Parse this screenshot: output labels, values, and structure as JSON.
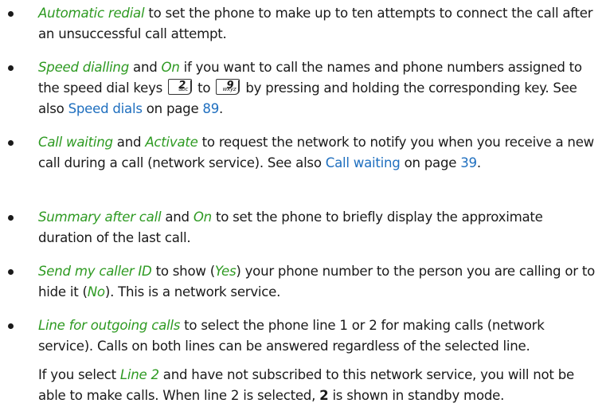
{
  "items": [
    {
      "term": "Automatic redial",
      "text": " to set the phone to make up to ten attempts to connect the call after an unsuccessful call attempt."
    },
    {
      "term": "Speed dialling",
      "and": " and ",
      "option": "On",
      "text1": " if you want to call the names and phone numbers assigned to the speed dial keys",
      "to": " to ",
      "text2": " by pressing and holding the corresponding key. See also ",
      "link": "Speed dials",
      "text3": " on page ",
      "page": "89",
      "end": ".",
      "key_from": {
        "digit": "2",
        "letters": "abc",
        "icon": "key-2-icon"
      },
      "key_to": {
        "digit": "9",
        "letters": "wxyz",
        "icon": "key-9-icon"
      }
    },
    {
      "term": "Call waiting",
      "and": " and ",
      "option": "Activate",
      "text1": " to request the network to notify you when you receive a new call during a call (network service). See also ",
      "link": "Call waiting",
      "text2": " on page ",
      "page": "39",
      "end": "."
    },
    {
      "term": "Summary after call",
      "and": " and ",
      "option": "On",
      "text": " to set the phone to briefly display the approximate duration of the last call."
    },
    {
      "term": "Send my caller ID",
      "text1": " to show (",
      "opt1": "Yes",
      "text2": ") your phone number to the person you are calling or to hide it (",
      "opt2": "No",
      "text3": "). This is a network service."
    },
    {
      "term": "Line for outgoing calls",
      "text": " to select the phone line 1 or 2 for making calls (network service). Calls on both lines can be answered regardless of the selected line.",
      "p2_a": "If you select ",
      "p2_opt": "Line 2",
      "p2_b": " and have not subscribed to this network service, you will not be able to make calls. When line 2 is selected, ",
      "p2_bold": "2",
      "p2_c": " is shown in standby mode."
    }
  ]
}
